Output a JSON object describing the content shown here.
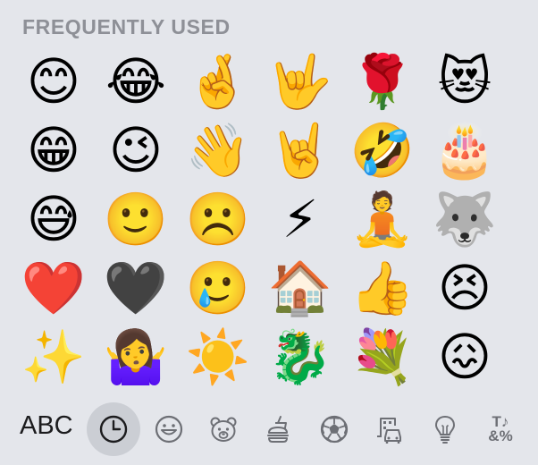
{
  "section": {
    "title": "FREQUENTLY USED"
  },
  "emojis": [
    "😊",
    "😂",
    "🤞",
    "🤟",
    "🌹",
    "😻",
    "😁",
    "😉",
    "👋",
    "🤘",
    "🤣",
    "🎂",
    "😅",
    "🙂",
    "☹️",
    "⚡",
    "🧘",
    "🐺",
    "❤️",
    "🖤",
    "🥲",
    "🏠",
    "👍",
    "😣",
    "✨",
    "🤷‍♀️",
    "☀️",
    "🐉",
    "💐",
    "😖"
  ],
  "bottom_bar": {
    "abc_label": "ABC",
    "symbols_line1": "T♪",
    "symbols_line2": "&%",
    "categories": [
      {
        "name": "recent",
        "icon": "clock-icon",
        "selected": true
      },
      {
        "name": "smileys",
        "icon": "smiley-icon",
        "selected": false
      },
      {
        "name": "animals",
        "icon": "bear-icon",
        "selected": false
      },
      {
        "name": "food",
        "icon": "burger-icon",
        "selected": false
      },
      {
        "name": "activity",
        "icon": "soccer-ball-icon",
        "selected": false
      },
      {
        "name": "travel",
        "icon": "building-car-icon",
        "selected": false
      },
      {
        "name": "objects",
        "icon": "lightbulb-icon",
        "selected": false
      },
      {
        "name": "symbols",
        "icon": "symbols-icon",
        "selected": false
      }
    ]
  }
}
